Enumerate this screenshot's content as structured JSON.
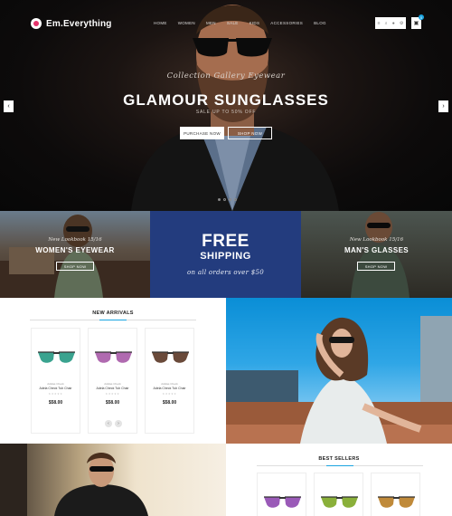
{
  "brand": {
    "name": "Em.Everything"
  },
  "nav": {
    "items": [
      "HOME",
      "WOMEN",
      "MEN",
      "SALE",
      "KIDS",
      "ACCESSORIES",
      "BLOG"
    ]
  },
  "tools": {
    "cart_count": "0"
  },
  "hero": {
    "subtitle": "Collection Gallery Eyewear",
    "title": "GLAMOUR SUNGLASSES",
    "sale": "SALE UP TO 50% OFF",
    "btn_primary": "PURCHASE NOW",
    "btn_secondary": "SHOP NOW",
    "slide_active": 1,
    "slide_count": 4
  },
  "banners": {
    "women": {
      "small": "New Lookbook 15/16",
      "title": "WOMEN'S EYEWEAR",
      "button": "SHOP NOW"
    },
    "free": {
      "line1": "FREE",
      "line2": "SHIPPING",
      "line3": "on all orders over $50"
    },
    "men": {
      "small": "New Lookbook 15/16",
      "title": "MAN'S GLASSES",
      "button": "SHOP NOW"
    }
  },
  "arrivals": {
    "title": "NEW ARRIVALS",
    "products": [
      {
        "brand": "Adidas Check",
        "name": "Adela Check Tub Chair",
        "rating": 0,
        "price": "$58.00",
        "lens": "#3aa38f"
      },
      {
        "brand": "Adidas Check",
        "name": "Adela Check Tub Chair",
        "rating": 0,
        "price": "$58.00",
        "lens": "#b06ab0"
      },
      {
        "brand": "Adidas Check",
        "name": "Adela Check Tub Chair",
        "rating": 0,
        "price": "$58.00",
        "lens": "#6a4a3a"
      }
    ]
  },
  "best": {
    "title": "BEST SELLERS",
    "products": [
      {
        "lens": "#9a5ab8"
      },
      {
        "lens": "#8ab03a"
      },
      {
        "lens": "#c08a3a"
      }
    ]
  },
  "colors": {
    "accent": "#1ba4e0",
    "banner_blue": "#233c7e"
  }
}
